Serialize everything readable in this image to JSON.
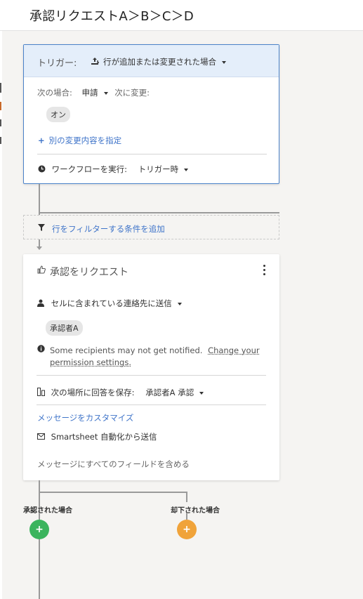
{
  "header": {
    "title": "承認リクエストA＞B＞C＞D"
  },
  "trigger": {
    "label": "トリガー:",
    "value": "行が追加または変更された場合",
    "when_label": "次の場合:",
    "when_value": "申請",
    "change_label": "次に変更:",
    "chip": "オン",
    "add_change": "別の変更内容を指定",
    "run_label": "ワークフローを実行:",
    "run_value": "トリガー時"
  },
  "filter": {
    "label": "行をフィルターする条件を追加"
  },
  "approval": {
    "title": "承認をリクエスト",
    "send_to": "セルに含まれている連絡先に送信",
    "chip": "承認者A",
    "notice": "Some recipients may not get notified.",
    "notice_link1": "Change your",
    "notice_link2": "permission settings.",
    "save_label": "次の場所に回答を保存:",
    "save_value": "承認者A 承認",
    "customize": "メッセージをカスタマイズ",
    "sender": "Smartsheet 自動化から送信",
    "include_fields": "メッセージにすべてのフィールドを含める"
  },
  "branches": {
    "approved": "承認された場合",
    "rejected": "却下された場合",
    "approved_color": "#3bb45d",
    "rejected_color": "#f0a33a"
  },
  "colors": {
    "accent": "#4a82c9",
    "link": "#3f74c9"
  }
}
